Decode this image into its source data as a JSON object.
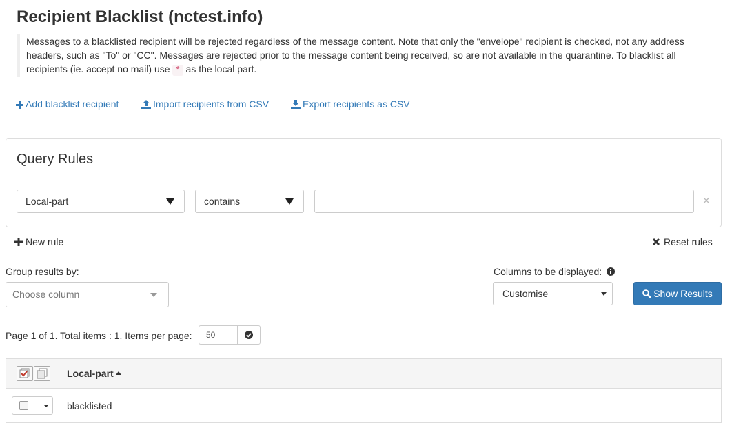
{
  "page": {
    "title": "Recipient Blacklist (nctest.info)",
    "description_part1": "Messages to a blacklisted recipient will be rejected regardless of the message content. Note that only the \"envelope\" recipient is checked, not any address headers, such as \"To\" or \"CC\". Messages are rejected prior to the message content being received, so are not available in the quarantine. To blacklist all recipients (ie. accept no mail) use ",
    "description_code": "*",
    "description_part2": " as the local part."
  },
  "actions": {
    "add": "Add blacklist recipient",
    "import": "Import recipients from CSV",
    "export": "Export recipients as CSV"
  },
  "query": {
    "title": "Query Rules",
    "field_selected": "Local-part",
    "operator_selected": "contains",
    "value": "",
    "new_rule": "New rule",
    "reset_rules": "Reset rules"
  },
  "controls": {
    "group_label": "Group results by:",
    "group_placeholder": "Choose column",
    "columns_label": "Columns to be displayed:",
    "columns_selected": "Customise",
    "show_results": "Show Results"
  },
  "pagination": {
    "text": "Page 1 of 1. Total items : 1. Items per page:",
    "per_page": "50"
  },
  "table": {
    "column_header": "Local-part",
    "rows": [
      {
        "local_part": "blacklisted"
      }
    ]
  },
  "colors": {
    "link": "#337ab7",
    "primary_button": "#337ab7",
    "code_text": "#c7254e"
  }
}
